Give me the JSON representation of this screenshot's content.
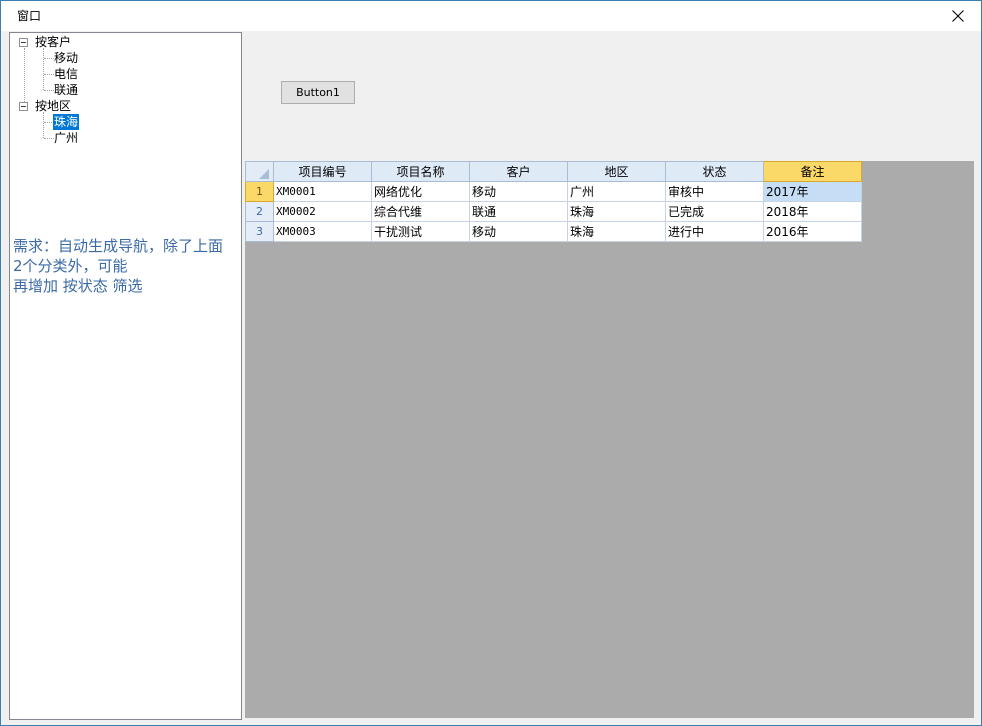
{
  "window": {
    "title": "窗口"
  },
  "tree": {
    "groups": [
      {
        "label": "按客户",
        "children": [
          "移动",
          "电信",
          "联通"
        ]
      },
      {
        "label": "按地区",
        "children": [
          "珠海",
          "广州"
        ]
      }
    ],
    "selected": "珠海"
  },
  "note": {
    "lines": [
      "需求：自动生成导航，除了上面",
      "2个分类外，可能",
      "再增加 按状态 筛选"
    ]
  },
  "button1": {
    "label": "Button1"
  },
  "grid": {
    "columns": [
      "项目编号",
      "项目名称",
      "客户",
      "地区",
      "状态",
      "备注"
    ],
    "rows": [
      {
        "num": "1",
        "cells": [
          "XM0001",
          "网络优化",
          "移动",
          "广州",
          "审核中",
          "2017年"
        ]
      },
      {
        "num": "2",
        "cells": [
          "XM0002",
          "综合代维",
          "联通",
          "珠海",
          "已完成",
          "2018年"
        ]
      },
      {
        "num": "3",
        "cells": [
          "XM0003",
          "干扰测试",
          "移动",
          "珠海",
          "进行中",
          "2016年"
        ]
      }
    ],
    "active_column": 5,
    "active_row": 0
  },
  "colors": {
    "accent": "#0078d7",
    "note_text": "#3b6aa6",
    "grid_background": "#ababab",
    "active_header": "#fbd968"
  },
  "icons": {
    "close": "close-icon",
    "expander": "tree-collapse-icon",
    "corner": "select-all-icon"
  }
}
